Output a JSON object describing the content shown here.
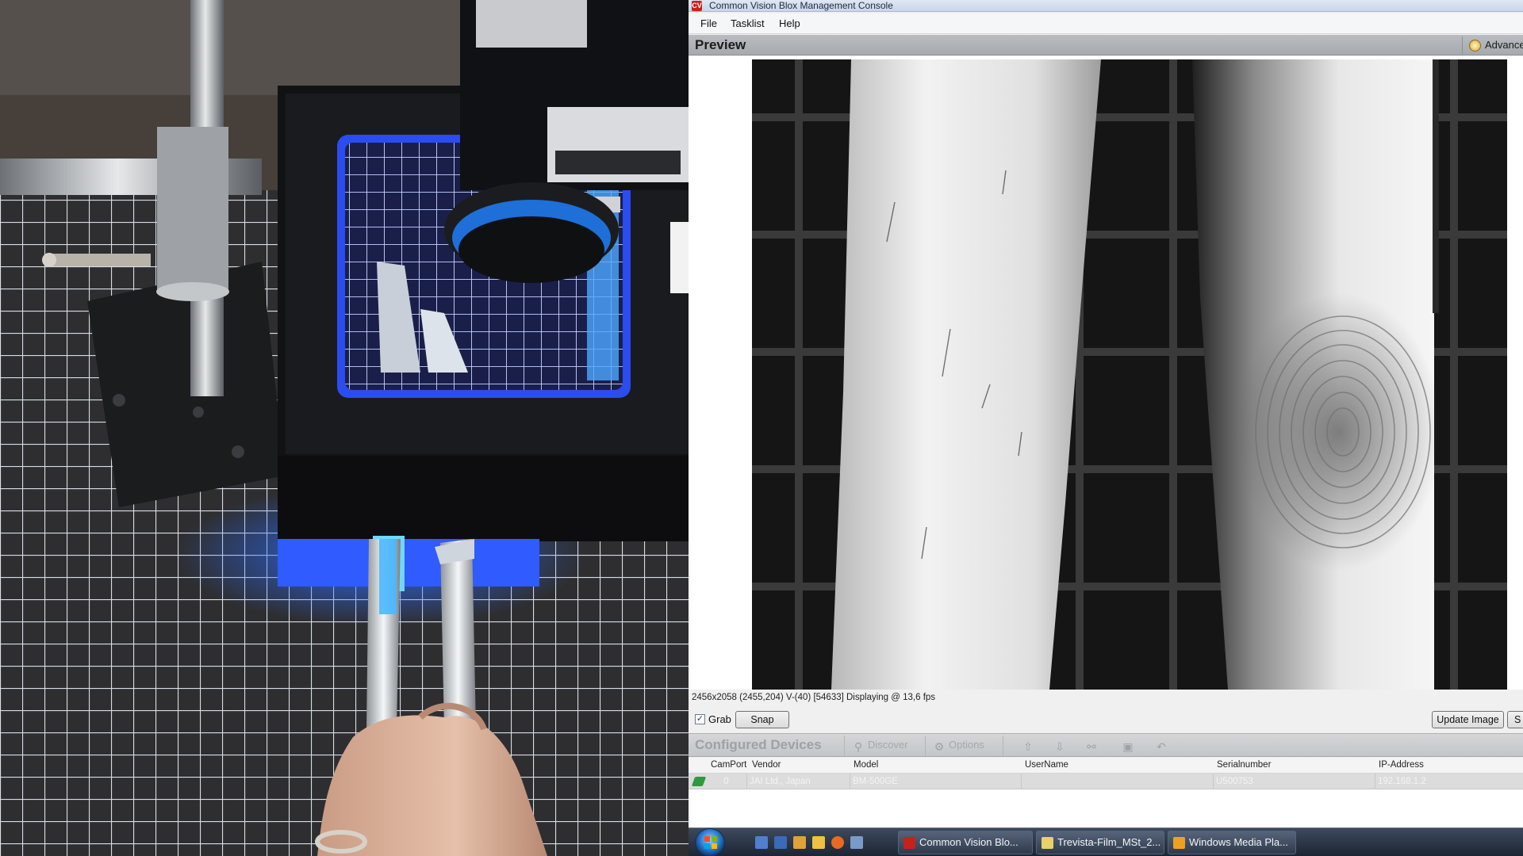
{
  "window": {
    "title": "Common Vision Blox Management Console",
    "icon_letter": "CV",
    "icon": "app-logo-icon"
  },
  "menu": {
    "items": [
      "File",
      "Tasklist",
      "Help"
    ]
  },
  "preview": {
    "title": "Preview",
    "advanced_label": "Advanced",
    "status_text": "2456x2058  (2455,204)  V-(40) [54633] Displaying @ 13,6 fps"
  },
  "grabbar": {
    "grab_label": "Grab",
    "grab_checked": true,
    "snap_label": "Snap",
    "update_image_label": "Update Image",
    "s_label": "S"
  },
  "devices": {
    "title": "Configured Devices",
    "toolbar": [
      {
        "label": "Discover",
        "icon": "discover-icon"
      },
      {
        "label": "Options",
        "icon": "options-icon"
      }
    ],
    "icon_buttons": [
      "move-up-icon",
      "move-down-icon",
      "link-icon",
      "save-icon",
      "undo-icon"
    ],
    "columns": [
      "CamPort",
      "Vendor",
      "Model",
      "UserName",
      "Serialnumber",
      "IP-Address"
    ],
    "rows": [
      {
        "camport": "0",
        "vendor": "JAI Ltd., Japan",
        "model": "BM-500GE",
        "username": "",
        "serial": "U500753",
        "ip": "192.168.1.2"
      }
    ]
  },
  "taskbar": {
    "start_icon": "windows-start-icon",
    "quick_launch": [
      "show-desktop-icon",
      "switch-windows-icon",
      "folder-icon",
      "media-icon",
      "firefox-icon",
      "explorer-icon"
    ],
    "tasks": [
      {
        "label": "Common Vision Blo...",
        "icon": "cvb-icon",
        "color": "#c8201c"
      },
      {
        "label": "Trevista-Film_MSt_2...",
        "icon": "document-icon",
        "color": "#e8d06a"
      },
      {
        "label": "Windows Media Pla...",
        "icon": "media-player-icon",
        "color": "#f0a020"
      }
    ]
  },
  "colors": {
    "accent_blue": "#1e6cff",
    "brand_red": "#c8201c",
    "status_green": "#2e9a3e"
  }
}
